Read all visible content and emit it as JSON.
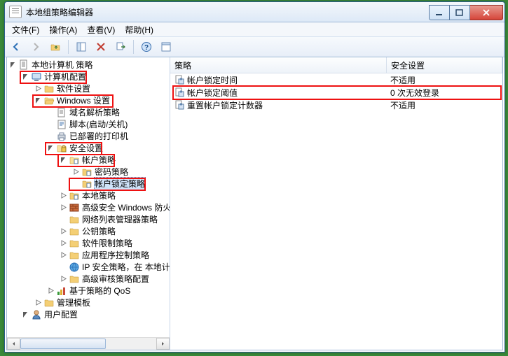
{
  "window": {
    "title": "本地组策略编辑器"
  },
  "menu": {
    "file": "文件(F)",
    "action": "操作(A)",
    "view": "查看(V)",
    "help": "帮助(H)"
  },
  "tree": {
    "root": "本地计算机 策略",
    "computer_config": "计算机配置",
    "software_settings": "软件设置",
    "windows_settings": "Windows 设置",
    "dns_policy": "域名解析策略",
    "scripts": "脚本(启动/关机)",
    "deployed_printers": "已部署的打印机",
    "security_settings": "安全设置",
    "account_policies": "帐户策略",
    "password_policy": "密码策略",
    "account_lockout_policy": "帐户锁定策略",
    "local_policies": "本地策略",
    "wfas": "高级安全 Windows 防火",
    "nlm": "网络列表管理器策略",
    "public_key": "公钥策略",
    "srp": "软件限制策略",
    "app_control": "应用程序控制策略",
    "ipsec": "IP 安全策略，在 本地计",
    "adv_audit": "高级审核策略配置",
    "qos": "基于策略的 QoS",
    "admin_templates": "管理模板",
    "user_config": "用户配置"
  },
  "list": {
    "header": {
      "policy": "策略",
      "setting": "安全设置"
    },
    "rows": [
      {
        "name": "帐户锁定时间",
        "value": "不适用"
      },
      {
        "name": "帐户锁定阈值",
        "value": "0 次无效登录"
      },
      {
        "name": "重置帐户锁定计数器",
        "value": "不适用"
      }
    ]
  }
}
